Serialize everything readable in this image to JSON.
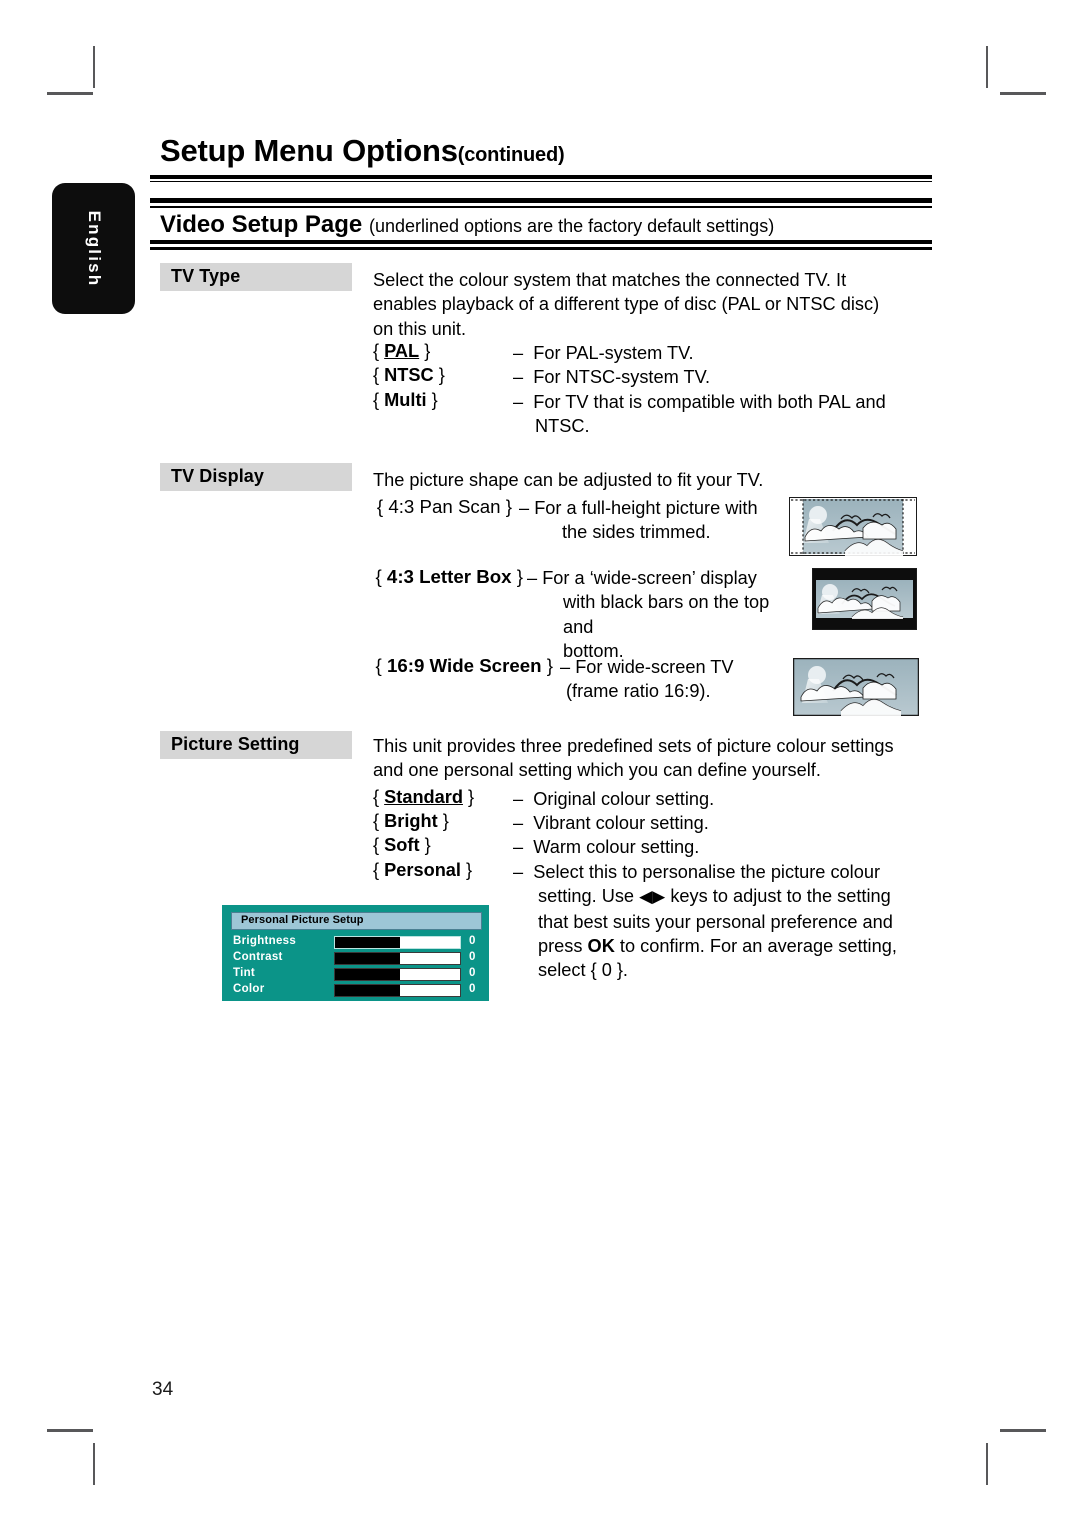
{
  "page": {
    "language_tab": "English",
    "title": "Setup Menu Options",
    "title_suffix": "(continued)",
    "folio": "34"
  },
  "section": {
    "heading": "Video Setup Page",
    "heading_note": "(underlined options are the factory default settings)"
  },
  "settings": [
    {
      "label": "TV Type",
      "intro": "Select the colour system that matches the connected TV. It enables playback of a different type of disc (PAL or NTSC disc) on this unit.",
      "options": [
        {
          "key": "PAL",
          "underlined": true,
          "dash": "–",
          "desc": "For PAL-system TV."
        },
        {
          "key": "NTSC",
          "underlined": false,
          "dash": "–",
          "desc": "For NTSC-system TV."
        },
        {
          "key": "Multi",
          "underlined": false,
          "dash": "–",
          "desc": "For TV that is compatible with both PAL and NTSC."
        }
      ]
    },
    {
      "label": "TV Display",
      "intro": "The picture shape can be adjusted to fit your TV.",
      "options": [
        {
          "key": "4:3 Pan Scan",
          "underlined": true,
          "dash": "–",
          "desc": "For a full-height picture with the sides trimmed.",
          "thumb": "pan-scan"
        },
        {
          "key": "4:3 Letter Box",
          "underlined": false,
          "dash": "–",
          "desc": "For a ‘wide-screen’ display with black bars on the top and bottom.",
          "thumb": "letter-box"
        },
        {
          "key": "16:9 Wide Screen",
          "underlined": false,
          "dash": "–",
          "desc": "For wide-screen TV (frame ratio 16:9).",
          "thumb": "wide-screen"
        }
      ]
    },
    {
      "label": "Picture Setting",
      "intro": "This unit provides three predefined sets of picture colour settings and one personal setting which you can define yourself.",
      "options": [
        {
          "key": "Standard",
          "underlined": true,
          "dash": "–",
          "desc": "Original colour setting."
        },
        {
          "key": "Bright",
          "underlined": false,
          "dash": "–",
          "desc": "Vibrant colour setting."
        },
        {
          "key": "Soft",
          "underlined": false,
          "dash": "–",
          "desc": "Warm colour setting."
        },
        {
          "key": "Personal",
          "underlined": false,
          "dash": "–",
          "desc": "Select this to personalise the picture colour setting. Use ◀▶ keys to adjust to the setting that best suits your personal preference and press OK to confirm. For an average setting, select { 0 }."
        }
      ]
    }
  ],
  "personal_picture_setup": {
    "title": "Personal Picture Setup",
    "rows": [
      {
        "name": "Brightness",
        "value": "0",
        "fill_percent": 52,
        "selected": true
      },
      {
        "name": "Contrast",
        "value": "0",
        "fill_percent": 52,
        "selected": false
      },
      {
        "name": "Tint",
        "value": "0",
        "fill_percent": 52,
        "selected": false
      },
      {
        "name": "Color",
        "value": "0",
        "fill_percent": 52,
        "selected": false
      }
    ],
    "colors": {
      "background": "#0b9488",
      "title_bar": "#9dc6d6",
      "bar_fill": "#000000",
      "bar_empty": "#ffffff",
      "text": "#ffffff"
    }
  },
  "colors": {
    "label_box": "#d6d6d6",
    "tab": "#0d0d0d",
    "rule": "#000000",
    "crop_mark": "#58585a"
  },
  "text_runs": {
    "tvtype_intro_l1": "Select the colour system that matches the connected TV. It",
    "tvtype_intro_l2": "enables playback of a different type of disc (PAL or NTSC disc)",
    "tvtype_intro_l3": "on this unit.",
    "tvtype_o1_desc": "For PAL-system TV.",
    "tvtype_o2_desc": "For NTSC-system TV.",
    "tvtype_o3_desc_l1": "For TV that is compatible with both PAL and",
    "tvtype_o3_desc_l2": "NTSC.",
    "tvdisplay_intro": "The picture shape can be adjusted to fit your TV.",
    "tvd_o1_desc_l1": "For a full-height picture with",
    "tvd_o1_desc_l2": "the sides trimmed.",
    "tvd_o2_desc_l1": "For a ‘wide-screen’ display",
    "tvd_o2_desc_l2": "with black bars on the top and",
    "tvd_o2_desc_l3": "bottom.",
    "tvd_o3_desc_l1": "For wide-screen TV",
    "tvd_o3_desc_l2": "(frame ratio 16:9).",
    "pic_intro_l1": "This unit provides three predefined sets of picture colour settings",
    "pic_intro_l2": "and one personal setting which you can define yourself.",
    "pic_o1_desc": "Original colour setting.",
    "pic_o2_desc": "Vibrant colour setting.",
    "pic_o3_desc": "Warm colour setting.",
    "pic_o4_l1": "Select this to personalise the picture colour",
    "pic_o4_l2a": "setting. Use",
    "pic_o4_l2b": "keys to adjust to the setting",
    "pic_o4_l3": "that best suits your personal preference and",
    "pic_o4_l4a": "press",
    "pic_o4_l4b": "OK",
    "pic_o4_l4c": "to confirm. For an average setting,",
    "pic_o4_l5": "select { 0 }.",
    "arrows": "◀▶",
    "brace_open": "{",
    "brace_close": "}",
    "dash": "–"
  }
}
